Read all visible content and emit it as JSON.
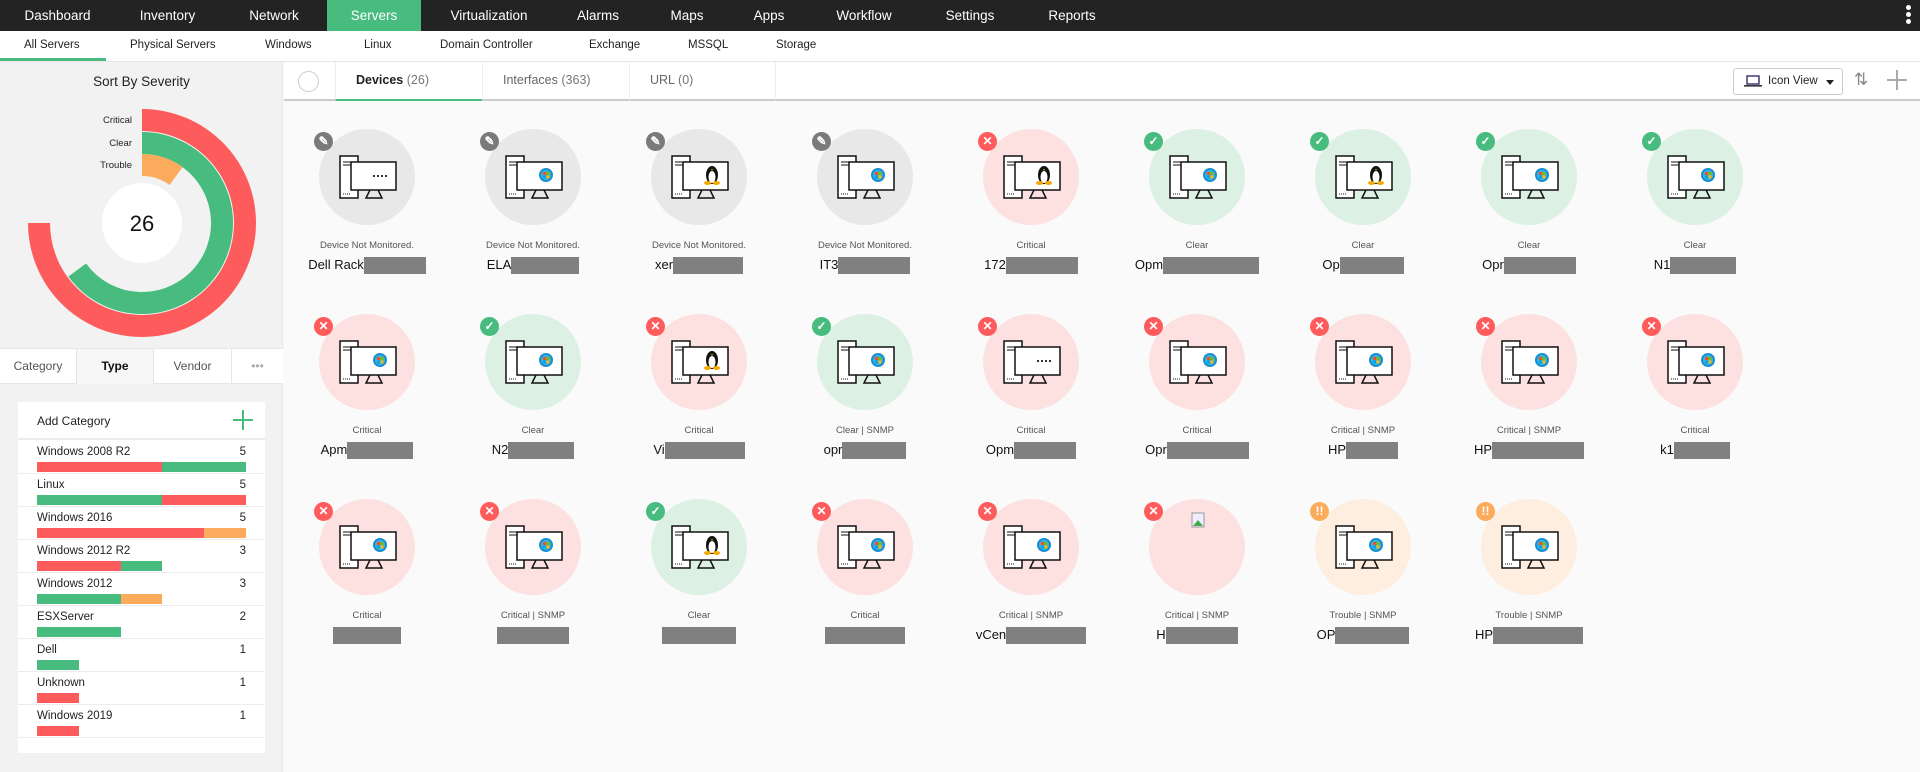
{
  "colors": {
    "accent": "#48bb7e",
    "critical": "#fe5c5c",
    "clear": "#48bb7e",
    "trouble": "#fbab5b",
    "not_monitored": "#7a7a7a"
  },
  "topnav": [
    "Dashboard",
    "Inventory",
    "Network",
    "Servers",
    "Virtualization",
    "Alarms",
    "Maps",
    "Apps",
    "Workflow",
    "Settings",
    "Reports"
  ],
  "topnav_active": "Servers",
  "subnav": [
    "All Servers",
    "Physical Servers",
    "Windows",
    "Linux",
    "Domain Controller",
    "Exchange",
    "MSSQL",
    "Storage"
  ],
  "sidebar": {
    "title": "Sort By Severity",
    "total": "26",
    "severity": [
      {
        "label": "Critical",
        "key": "critical",
        "arc_fraction": 0.75
      },
      {
        "label": "Clear",
        "key": "clear",
        "arc_fraction": 0.65
      },
      {
        "label": "Trouble",
        "key": "trouble",
        "arc_fraction": 0.1
      }
    ],
    "group_tabs": [
      "Category",
      "Type",
      "Vendor",
      "•••"
    ],
    "group_active": "Type",
    "add_category": "Add Category",
    "categories": [
      {
        "name": "Windows 2008 R2",
        "count": "5",
        "segments": [
          [
            "critical",
            3
          ],
          [
            "clear",
            2
          ]
        ]
      },
      {
        "name": "Linux",
        "count": "5",
        "segments": [
          [
            "clear",
            3
          ],
          [
            "critical",
            2
          ]
        ]
      },
      {
        "name": "Windows 2016",
        "count": "5",
        "segments": [
          [
            "critical",
            4
          ],
          [
            "trouble",
            1
          ]
        ]
      },
      {
        "name": "Windows 2012 R2",
        "count": "3",
        "segments": [
          [
            "critical",
            2
          ],
          [
            "clear",
            1
          ]
        ]
      },
      {
        "name": "Windows 2012",
        "count": "3",
        "segments": [
          [
            "clear",
            2
          ],
          [
            "trouble",
            1
          ]
        ]
      },
      {
        "name": "ESXServer",
        "count": "2",
        "segments": [
          [
            "clear",
            2
          ]
        ]
      },
      {
        "name": "Dell",
        "count": "1",
        "segments": [
          [
            "clear",
            1
          ]
        ]
      },
      {
        "name": "Unknown",
        "count": "1",
        "segments": [
          [
            "critical",
            1
          ]
        ]
      },
      {
        "name": "Windows 2019",
        "count": "1",
        "segments": [
          [
            "critical",
            1
          ]
        ]
      }
    ]
  },
  "main": {
    "tabs": [
      {
        "label": "Devices",
        "count": "(26)"
      },
      {
        "label": "Interfaces",
        "count": "(363)"
      },
      {
        "label": "URL",
        "count": "(0)"
      }
    ],
    "view_button": "Icon View",
    "devices": [
      {
        "name": "Dell Rack",
        "status": "not_monitored",
        "label": "Device Not Monitored.",
        "os": "unknown"
      },
      {
        "name": "ELA",
        "status": "not_monitored",
        "label": "Device Not Monitored.",
        "os": "windows"
      },
      {
        "name": "xer",
        "status": "not_monitored",
        "label": "Device Not Monitored.",
        "os": "linux"
      },
      {
        "name": "IT3",
        "status": "not_monitored",
        "label": "Device Not Monitored.",
        "os": "windows"
      },
      {
        "name": "172",
        "status": "critical",
        "label": "Critical",
        "os": "linux"
      },
      {
        "name": "Opm",
        "status": "clear",
        "label": "Clear",
        "os": "windows"
      },
      {
        "name": "Op",
        "status": "clear",
        "label": "Clear",
        "os": "linux"
      },
      {
        "name": "Opr",
        "status": "clear",
        "label": "Clear",
        "os": "windows"
      },
      {
        "name": "N1",
        "status": "clear",
        "label": "Clear",
        "os": "windows"
      },
      {
        "name": "Apm",
        "status": "critical",
        "label": "Critical",
        "os": "windows"
      },
      {
        "name": "N2",
        "status": "clear",
        "label": "Clear",
        "os": "windows"
      },
      {
        "name": "Vi",
        "status": "critical",
        "label": "Critical",
        "os": "linux"
      },
      {
        "name": "opr",
        "status": "clear",
        "label": "Clear  |  SNMP",
        "os": "windows"
      },
      {
        "name": "Opm",
        "status": "critical",
        "label": "Critical",
        "os": "unknown"
      },
      {
        "name": "Opr",
        "status": "critical",
        "label": "Critical",
        "os": "windows"
      },
      {
        "name": "HP",
        "status": "critical",
        "label": "Critical  |  SNMP",
        "os": "windows"
      },
      {
        "name": "HP",
        "status": "critical",
        "label": "Critical  |  SNMP",
        "os": "windows"
      },
      {
        "name": "k1",
        "status": "critical",
        "label": "Critical",
        "os": "windows"
      },
      {
        "name": "",
        "status": "critical",
        "label": "Critical",
        "os": "windows"
      },
      {
        "name": "",
        "status": "critical",
        "label": "Critical  |  SNMP",
        "os": "windows"
      },
      {
        "name": "",
        "status": "clear",
        "label": "Clear",
        "os": "linux"
      },
      {
        "name": "",
        "status": "critical",
        "label": "Critical",
        "os": "windows"
      },
      {
        "name": "vCen",
        "status": "critical",
        "label": "Critical  |  SNMP",
        "os": "windows"
      },
      {
        "name": "H",
        "status": "critical",
        "label": "Critical  |  SNMP",
        "os": "broken-image"
      },
      {
        "name": "OP",
        "status": "trouble",
        "label": "Trouble  |  SNMP",
        "os": "windows"
      },
      {
        "name": "HP",
        "status": "trouble",
        "label": "Trouble  |  SNMP",
        "os": "windows"
      }
    ]
  }
}
